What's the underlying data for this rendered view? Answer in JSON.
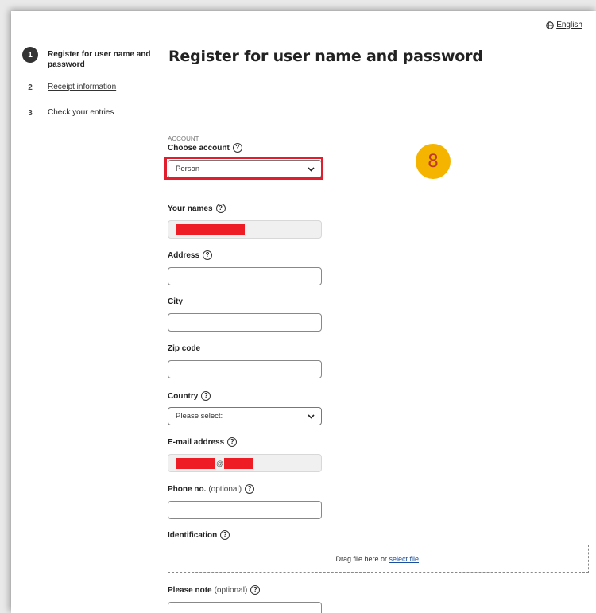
{
  "language": {
    "label": "English",
    "icon": "globe-icon"
  },
  "steps": [
    {
      "number": "1",
      "label": "Register for user name and password",
      "active": true
    },
    {
      "number": "2",
      "label": "Receipt information",
      "active": false
    },
    {
      "number": "3",
      "label": "Check your entries",
      "active": false
    }
  ],
  "page": {
    "title": "Register for user name and password"
  },
  "form": {
    "section_label": "ACCOUNT",
    "choose_account": {
      "label": "Choose account",
      "value": "Person"
    },
    "your_names": {
      "label": "Your names"
    },
    "address": {
      "label": "Address",
      "value": ""
    },
    "city": {
      "label": "City",
      "value": ""
    },
    "zip": {
      "label": "Zip code",
      "value": ""
    },
    "country": {
      "label": "Country",
      "value": "Please select:"
    },
    "email": {
      "label": "E-mail address",
      "at_sign": "@"
    },
    "phone": {
      "label": "Phone no.",
      "optional": "(optional)",
      "value": ""
    },
    "identification": {
      "label": "Identification",
      "drop_text": "Drag file here or ",
      "select_link": "select file",
      "period": "."
    },
    "note": {
      "label": "Please note",
      "optional": "(optional)",
      "value": ""
    }
  },
  "annotation": {
    "number": "8",
    "color": "#f4b400",
    "highlight_color": "#e11d2e"
  },
  "help_glyph": "?"
}
